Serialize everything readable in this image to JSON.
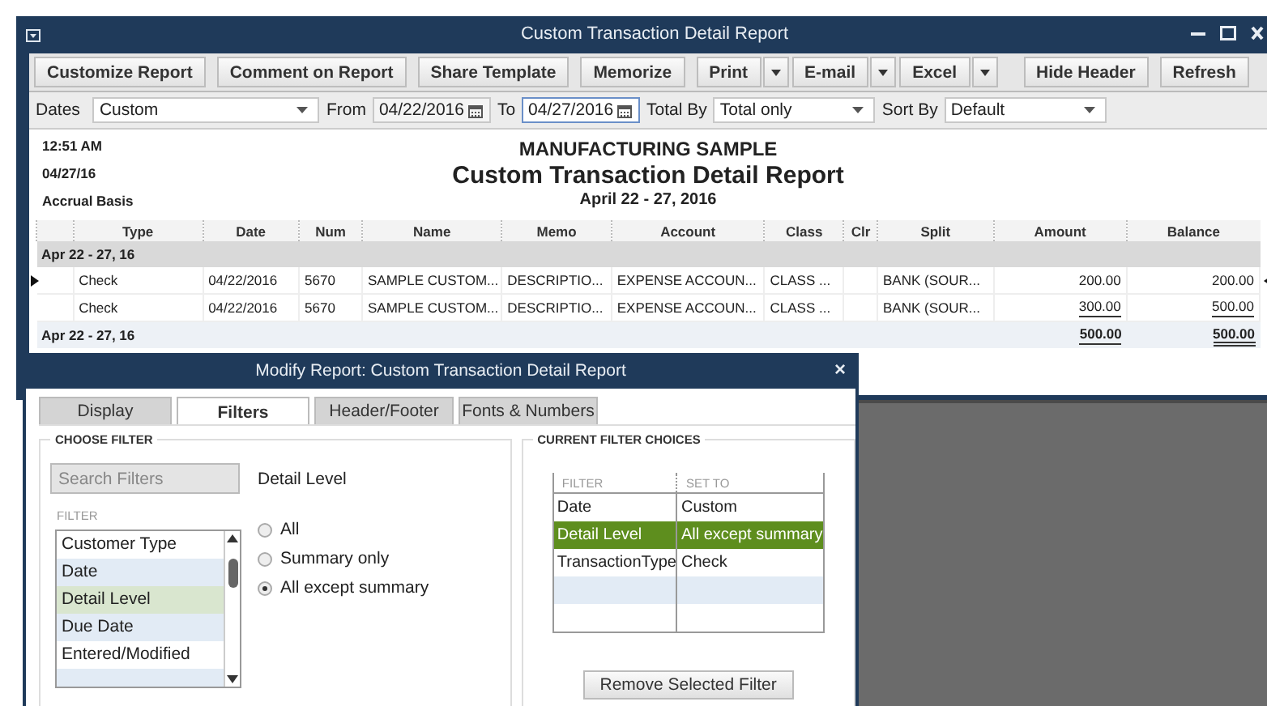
{
  "window": {
    "title": "Custom Transaction Detail Report"
  },
  "toolbar": [
    {
      "label": "Customize Report",
      "kind": "button"
    },
    {
      "label": "Comment on Report",
      "kind": "button"
    },
    {
      "label": "Share Template",
      "kind": "button"
    },
    {
      "label": "Memorize",
      "kind": "button"
    },
    {
      "label": "Print",
      "kind": "split"
    },
    {
      "label": "E-mail",
      "kind": "split"
    },
    {
      "label": "Excel",
      "kind": "split"
    },
    {
      "label": "Hide Header",
      "kind": "button"
    },
    {
      "label": "Refresh",
      "kind": "button"
    }
  ],
  "filter_bar": {
    "dates_label": "Dates",
    "dates": "Custom",
    "from_label": "From",
    "from": "04/22/2016",
    "to_label": "To",
    "to": "04/27/2016",
    "total_by_label": "Total By",
    "total_by": "Total only",
    "sort_by_label": "Sort By",
    "sort_by": "Default"
  },
  "report_header": {
    "time": "12:51 AM",
    "date": "04/27/16",
    "basis": "Accrual Basis",
    "company": "MANUFACTURING SAMPLE",
    "title": "Custom Transaction Detail Report",
    "date_range": "April 22 - 27, 2016"
  },
  "table": {
    "columns": [
      "Type",
      "Date",
      "Num",
      "Name",
      "Memo",
      "Account",
      "Class",
      "Clr",
      "Split",
      "Amount",
      "Balance"
    ],
    "group": "Apr 22 - 27, 16",
    "rows": [
      {
        "selected": true,
        "cells": [
          "Check",
          "04/22/2016",
          "5670",
          "SAMPLE CUSTOM...",
          "DESCRIPTIO...",
          "EXPENSE ACCOUN...",
          "CLASS ...",
          "",
          "BANK (SOUR...",
          "200.00",
          "200.00"
        ]
      },
      {
        "selected": false,
        "cells": [
          "Check",
          "04/22/2016",
          "5670",
          "SAMPLE CUSTOM...",
          "DESCRIPTIO...",
          "EXPENSE ACCOUN...",
          "CLASS ...",
          "",
          "BANK (SOUR...",
          "300.00",
          "500.00"
        ]
      }
    ],
    "total": {
      "label": "Apr 22 - 27, 16",
      "amount": "500.00",
      "balance": "500.00"
    }
  },
  "dialog": {
    "title": "Modify Report: Custom Transaction Detail Report",
    "close": "×",
    "tabs": [
      {
        "label": "Display",
        "selected": false
      },
      {
        "label": "Filters",
        "selected": true
      },
      {
        "label": "Header/Footer",
        "selected": false
      },
      {
        "label": "Fonts & Numbers",
        "selected": false
      }
    ],
    "choose_filter": {
      "legend": "CHOOSE FILTER",
      "search_placeholder": "Search Filters",
      "list_header": "FILTER",
      "items": [
        {
          "label": "Customer Type",
          "selected": false
        },
        {
          "label": "Date",
          "selected": false
        },
        {
          "label": "Detail Level",
          "selected": true
        },
        {
          "label": "Due Date",
          "selected": false
        },
        {
          "label": "Entered/Modified",
          "selected": false
        }
      ],
      "detail_heading": "Detail Level",
      "options": [
        {
          "label": "All",
          "selected": false
        },
        {
          "label": "Summary only",
          "selected": false
        },
        {
          "label": "All except summary",
          "selected": true
        }
      ]
    },
    "current": {
      "legend": "CURRENT FILTER CHOICES",
      "columns": [
        "FILTER",
        "SET TO"
      ],
      "rows": [
        {
          "filter": "Date",
          "set_to": "Custom",
          "selected": false
        },
        {
          "filter": "Detail Level",
          "set_to": "All except summary",
          "selected": true
        },
        {
          "filter": "TransactionType",
          "set_to": "Check",
          "selected": false
        }
      ],
      "remove_button": "Remove Selected Filter"
    }
  }
}
